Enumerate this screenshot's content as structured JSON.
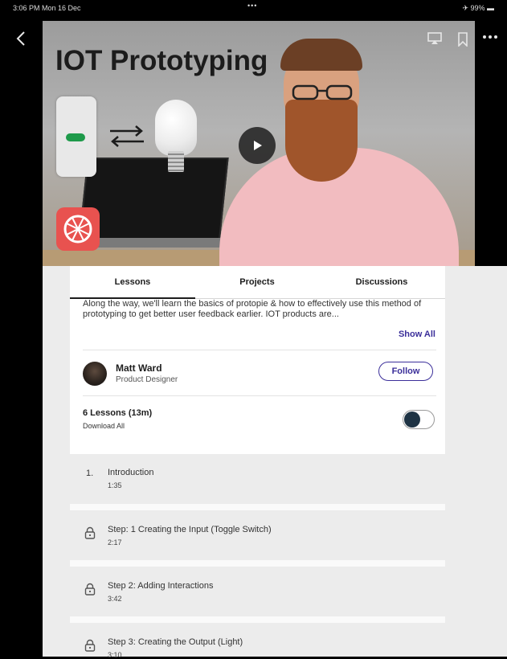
{
  "status_bar": {
    "time": "3:06 PM  Mon 16 Dec",
    "dots": "•••",
    "right": "✈ 99% ▬"
  },
  "video": {
    "title": "IOT Prototyping"
  },
  "tabs": [
    {
      "label": "Lessons"
    },
    {
      "label": "Projects"
    },
    {
      "label": "Discussions"
    }
  ],
  "course": {
    "description": "Along the way, we'll learn the basics of protopie & how to effectively use this method of prototyping to get better user feedback earlier.  IOT products are...",
    "show_all": "Show All",
    "instructor": {
      "name": "Matt Ward",
      "role": "Product Designer",
      "follow_label": "Follow"
    },
    "lessons_summary": "6 Lessons (13m)",
    "download_all": "Download All",
    "download_toggle_on": false
  },
  "lessons": [
    {
      "number": "1.",
      "title": "Introduction",
      "duration": "1:35",
      "locked": false
    },
    {
      "number": "",
      "title": "Step: 1 Creating the Input (Toggle Switch)",
      "duration": "2:17",
      "locked": true
    },
    {
      "number": "",
      "title": "Step 2: Adding Interactions",
      "duration": "3:42",
      "locked": true
    },
    {
      "number": "",
      "title": "Step 3: Creating the Output (Light)",
      "duration": "3:10",
      "locked": true
    }
  ],
  "colors": {
    "accent": "#3b2f9a",
    "panel_bg": "#ececec",
    "toggle_knob": "#1e3344"
  }
}
